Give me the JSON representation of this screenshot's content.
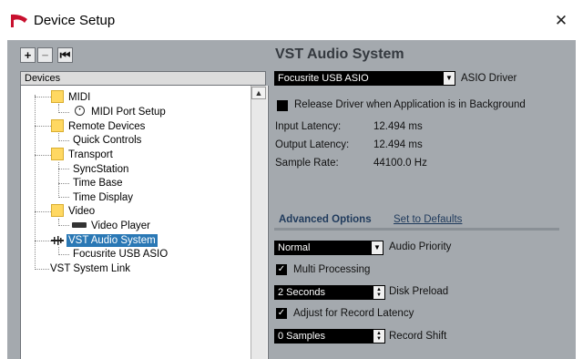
{
  "window": {
    "title": "Device Setup",
    "close_symbol": "✕"
  },
  "toolbar": {
    "add": "+",
    "remove": "−",
    "reset": "⏮"
  },
  "tree": {
    "header": "Devices",
    "nodes": {
      "midi": "MIDI",
      "midi_port_setup": "MIDI Port Setup",
      "remote_devices": "Remote Devices",
      "quick_controls": "Quick Controls",
      "transport": "Transport",
      "syncstation": "SyncStation",
      "time_base": "Time Base",
      "time_display": "Time Display",
      "video": "Video",
      "video_player": "Video Player",
      "vst_audio_system": "VST Audio System",
      "focusrite_usb_asio": "Focusrite USB ASIO",
      "vst_system_link": "VST System Link"
    },
    "selected": "VST Audio System"
  },
  "panel": {
    "title": "VST Audio System",
    "asio_driver_value": "Focusrite USB ASIO",
    "asio_driver_label": "ASIO Driver",
    "release_driver_label": "Release Driver when Application is in Background",
    "release_driver_checked": false,
    "input_latency_label": "Input Latency:",
    "input_latency_value": "12.494 ms",
    "output_latency_label": "Output Latency:",
    "output_latency_value": "12.494 ms",
    "sample_rate_label": "Sample Rate:",
    "sample_rate_value": "44100.0 Hz",
    "advanced_options": "Advanced Options",
    "set_to_defaults": "Set to Defaults",
    "audio_priority_value": "Normal",
    "audio_priority_label": "Audio Priority",
    "multi_processing_label": "Multi Processing",
    "multi_processing_checked": true,
    "disk_preload_value": "2 Seconds",
    "disk_preload_label": "Disk Preload",
    "adjust_latency_label": "Adjust for Record Latency",
    "adjust_latency_checked": true,
    "record_shift_value": "0 Samples",
    "record_shift_label": "Record Shift"
  },
  "colors": {
    "brand": "#c8102e",
    "selection": "#2a78b5",
    "panel": "#a4a9ae"
  }
}
